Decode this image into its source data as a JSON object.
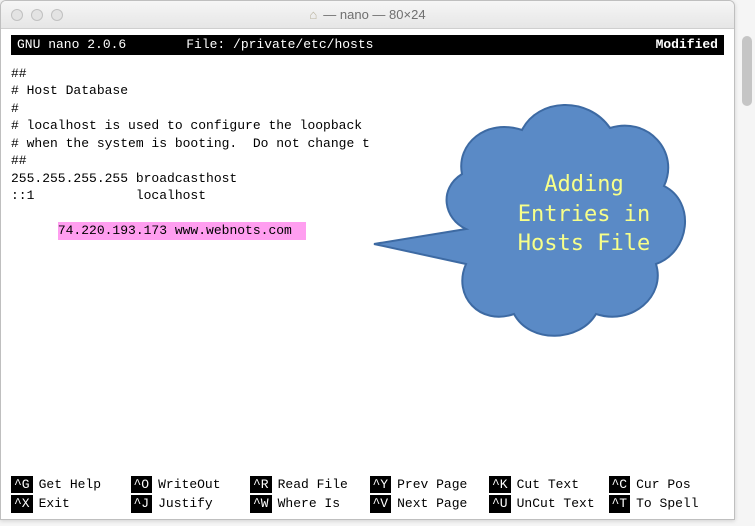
{
  "window": {
    "title": "— nano — 80×24"
  },
  "nano": {
    "version": "GNU nano 2.0.6",
    "file_label": "File: /private/etc/hosts",
    "status": "Modified"
  },
  "content": {
    "l0": "##",
    "l1": "# Host Database",
    "l2": "#",
    "l3": "# localhost is used to configure the loopback",
    "l4": "# when the system is booting.  Do not change t",
    "l5": "##",
    "l6": "255.255.255.255 broadcasthost",
    "l7": "::1             localhost",
    "highlighted": "74.220.193.173 www.webnots.com "
  },
  "callout": {
    "line1": "Adding",
    "line2": "Entries in",
    "line3": "Hosts File"
  },
  "shortcuts": {
    "row1": [
      {
        "key": "^G",
        "label": "Get Help"
      },
      {
        "key": "^O",
        "label": "WriteOut"
      },
      {
        "key": "^R",
        "label": "Read File"
      },
      {
        "key": "^Y",
        "label": "Prev Page"
      },
      {
        "key": "^K",
        "label": "Cut Text"
      },
      {
        "key": "^C",
        "label": "Cur Pos"
      }
    ],
    "row2": [
      {
        "key": "^X",
        "label": "Exit"
      },
      {
        "key": "^J",
        "label": "Justify"
      },
      {
        "key": "^W",
        "label": "Where Is"
      },
      {
        "key": "^V",
        "label": "Next Page"
      },
      {
        "key": "^U",
        "label": "UnCut Text"
      },
      {
        "key": "^T",
        "label": "To Spell"
      }
    ]
  }
}
